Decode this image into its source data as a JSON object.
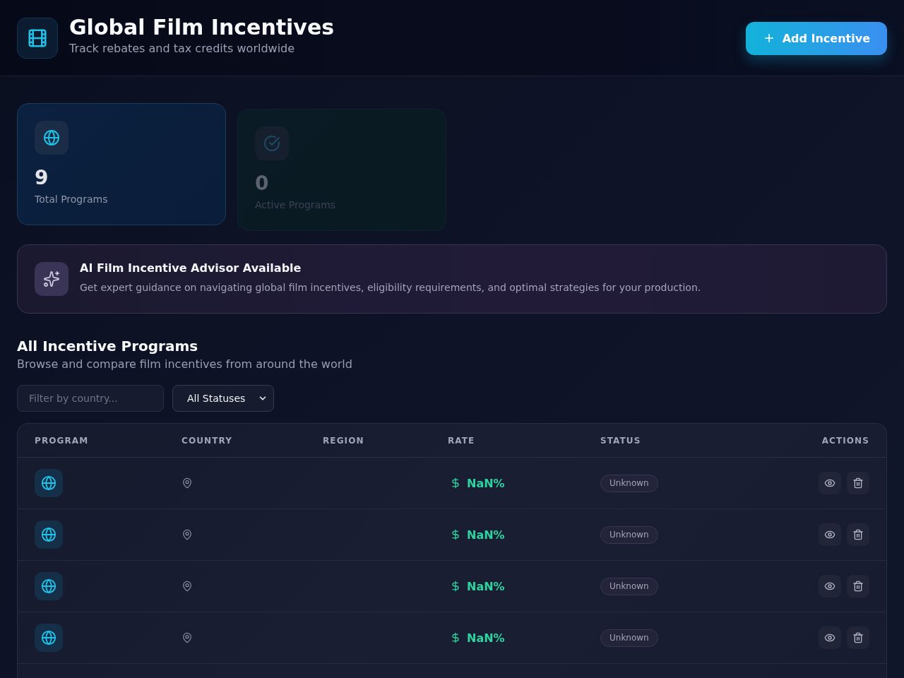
{
  "header": {
    "title": "Global Film Incentives",
    "subtitle": "Track rebates and tax credits worldwide",
    "add_button": "Add Incentive"
  },
  "stats": [
    {
      "kind": "total",
      "value": "9",
      "label": "Total Programs"
    },
    {
      "kind": "active",
      "value": "0",
      "label": "Active Programs"
    }
  ],
  "advisor_banner": {
    "title": "AI Film Incentive Advisor Available",
    "text": "Get expert guidance on navigating global film incentives, eligibility requirements, and optimal strategies for your production."
  },
  "section": {
    "title": "All Incentive Programs",
    "subtitle": "Browse and compare film incentives from around the world"
  },
  "filters": {
    "country": {
      "placeholder": "Filter by country..."
    },
    "status": {
      "value": "All Statuses"
    }
  },
  "table": {
    "columns": [
      "PROGRAM",
      "COUNTRY",
      "REGION",
      "RATE",
      "STATUS",
      "ACTIONS"
    ],
    "rows": [
      {
        "rate": "NaN%",
        "status": {
          "label": "Unknown",
          "kind": "unknown"
        }
      },
      {
        "rate": "NaN%",
        "status": {
          "label": "Unknown",
          "kind": "unknown"
        }
      },
      {
        "rate": "NaN%",
        "status": {
          "label": "Unknown",
          "kind": "unknown"
        }
      },
      {
        "rate": "NaN%",
        "status": {
          "label": "Unknown",
          "kind": "unknown"
        }
      }
    ]
  }
}
